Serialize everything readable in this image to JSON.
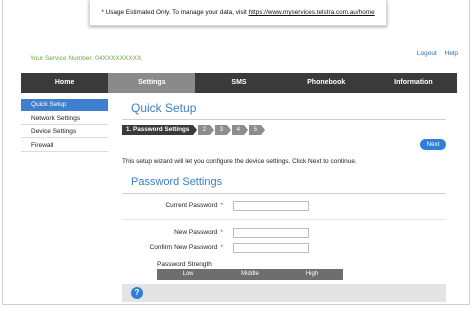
{
  "banner": {
    "text": "* Usage Estimated Only. To manage your data, visit",
    "link": "https://www.myservices.telstra.com.au/home"
  },
  "service_number": "Your Service Number: 04XXXXXXXXX",
  "top_links": {
    "logout": "Logout",
    "help": "Help"
  },
  "nav": {
    "items": [
      {
        "label": "Home"
      },
      {
        "label": "Settings"
      },
      {
        "label": "SMS"
      },
      {
        "label": "Phonebook"
      },
      {
        "label": "Information"
      }
    ],
    "active": "Settings"
  },
  "sidebar": {
    "items": [
      {
        "label": "Quick Setup"
      },
      {
        "label": "Network Settings"
      },
      {
        "label": "Device Settings"
      },
      {
        "label": "Firewall"
      }
    ],
    "active": "Quick Setup"
  },
  "page_title": "Quick Setup",
  "steps": {
    "current": "1. Password Settings",
    "others": [
      "2",
      "3",
      "4",
      "5"
    ]
  },
  "next_label": "Next",
  "intro_text": "This setup wizard will let you configure the device settings. Click Next to continue.",
  "section_title": "Password Settings",
  "form": {
    "current_password_label": "Current Password",
    "new_password_label": "New Password",
    "confirm_password_label": "Confirm New Password",
    "required_mark": "*",
    "current_password_value": "",
    "new_password_value": "",
    "confirm_password_value": ""
  },
  "strength": {
    "label": "Password Strength",
    "levels": [
      "Low",
      "Middle",
      "High"
    ]
  },
  "help_icon": "?",
  "colors": {
    "accent_blue": "#3c7ec4",
    "nav_dark": "#3a3a3a",
    "nav_active": "#8a8a8a",
    "service_green": "#6ca845",
    "required_red": "#e0301e"
  }
}
